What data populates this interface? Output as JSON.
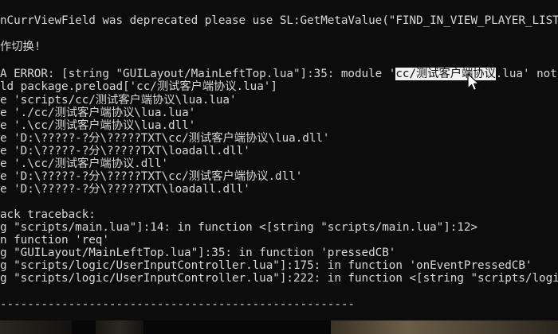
{
  "console": {
    "lines": [
      "nCurrViewField was deprecated please use SL:GetMetaValue(\"FIND_IN_VIEW_PLAYER_LIST\") ins",
      "",
      "作切换!",
      "",
      "A ERROR: [string \"GUILayout/MainLeftTop.lua\"]:35: module '",
      "ld package.preload['cc/测试客户端协议.lua']",
      "e 'scripts/cc/测试客户端协议\\lua.lua'",
      "e './cc/测试客户端协议\\lua.lua'",
      "e '.\\cc/测试客户端协议\\lua.dll'",
      "e 'D:\\?????-?分\\?????TXT\\cc/测试客户端协议\\lua.dll'",
      "e 'D:\\?????-?分\\?????TXT\\loadall.dll'",
      "e '.\\cc/测试客户端协议.dll'",
      "e 'D:\\?????-?分\\?????TXT\\cc/测试客户端协议.dll'",
      "e 'D:\\?????-?分\\?????TXT\\loadall.dll'",
      "",
      "ack traceback:",
      "g \"scripts/main.lua\"]:14: in function <[string \"scripts/main.lua\"]:12>",
      "n function 'req'",
      "g \"GUILayout/MainLeftTop.lua\"]:35: in function 'pressedCB'",
      "g \"scripts/logic/UserInputController.lua\"]:175: in function 'onEventPressedCB'",
      "g \"scripts/logic/UserInputController.lua\"]:222: in function <[string \"scripts/logic/User",
      "",
      "----------------------------------------------------"
    ],
    "error_line_selected": "cc/测试客户端协议",
    "error_line_tail": ".lua' not fou",
    "colors": {
      "background": "#0c0c0c",
      "text": "#d8d8d8",
      "selection_bg": "#f2f2f2",
      "selection_text": "#0c0c0c"
    }
  },
  "cursor": {
    "icon": "mouse-pointer-icon"
  }
}
